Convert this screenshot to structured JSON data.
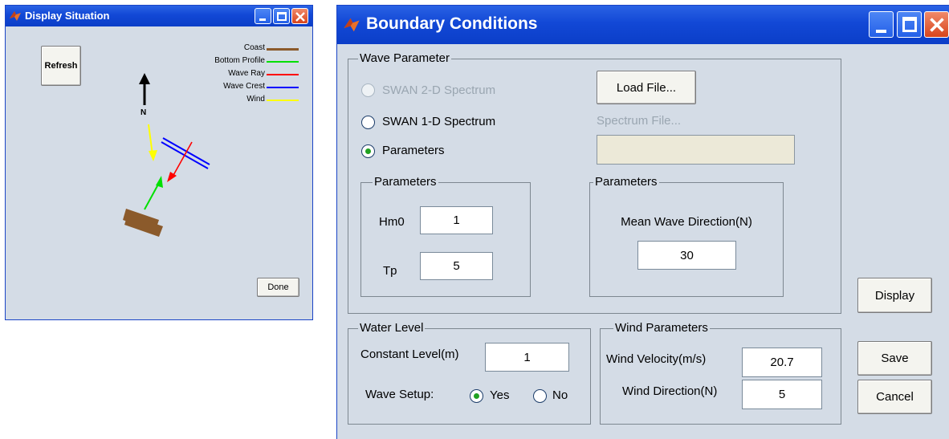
{
  "display_window": {
    "title": "Display Situation",
    "refresh_label": "Refresh",
    "done_label": "Done",
    "north_label": "N",
    "legend": [
      {
        "label": "Coast",
        "color": "#8b5a2b"
      },
      {
        "label": "Bottom Profile",
        "color": "#00e000"
      },
      {
        "label": "Wave Ray",
        "color": "#ff0000"
      },
      {
        "label": "Wave Crest",
        "color": "#0000ff"
      },
      {
        "label": "Wind",
        "color": "#ffff00"
      }
    ]
  },
  "boundary_window": {
    "title": "Boundary Conditions",
    "wave_parameter": {
      "title": "Wave Parameter",
      "options": [
        {
          "label": "SWAN 2-D Spectrum",
          "disabled": true,
          "selected": false
        },
        {
          "label": "SWAN 1-D Spectrum",
          "disabled": false,
          "selected": false
        },
        {
          "label": "Parameters",
          "disabled": false,
          "selected": true
        }
      ],
      "load_file_label": "Load File...",
      "spectrum_file_label": "Spectrum File...",
      "spectrum_file_value": ""
    },
    "parameters_left": {
      "title": "Parameters",
      "hm0_label": "Hm0",
      "hm0_value": "1",
      "tp_label": "Tp",
      "tp_value": "5"
    },
    "parameters_right": {
      "title": "Parameters",
      "mean_dir_label": "Mean Wave Direction(N)",
      "mean_dir_value": "30"
    },
    "water_level": {
      "title": "Water Level",
      "constant_label": "Constant Level(m)",
      "constant_value": "1",
      "wave_setup_label": "Wave Setup:",
      "yes_label": "Yes",
      "no_label": "No",
      "wave_setup_selected": "Yes"
    },
    "wind": {
      "title": "Wind Parameters",
      "velocity_label": "Wind Velocity(m/s)",
      "velocity_value": "20.7",
      "direction_label": "Wind Direction(N)",
      "direction_value": "5"
    },
    "buttons": {
      "display": "Display",
      "save": "Save",
      "cancel": "Cancel"
    }
  },
  "colors": {
    "titlebar": "#1248d6",
    "window_bg": "#d4dce6",
    "radio_dot": "#21a121"
  }
}
